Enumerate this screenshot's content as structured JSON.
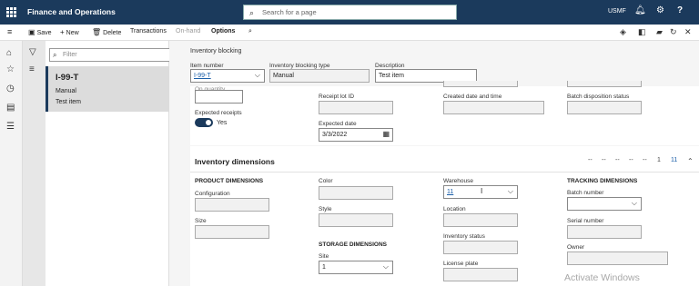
{
  "app": {
    "title": "Finance and Operations",
    "search_placeholder": "Search for a page",
    "company": "USMF"
  },
  "commands": {
    "save": "Save",
    "new": "New",
    "delete": "Delete",
    "transactions": "Transactions",
    "on_hand": "On-hand",
    "options": "Options"
  },
  "filter": {
    "placeholder": "Filter"
  },
  "list_item": {
    "id": "I-99-T",
    "type": "Manual",
    "description": "Test item"
  },
  "header": {
    "page_title": "Inventory blocking",
    "item_number_label": "Item number",
    "item_number_value": "I-99-T",
    "blocking_type_label": "Inventory blocking type",
    "blocking_type_value": "Manual",
    "description_label": "Description",
    "description_value": "Test item"
  },
  "general": {
    "quantity_label": "On quantity",
    "expected_receipts_label": "Expected receipts",
    "expected_receipts_value": "Yes",
    "receipt_lot_label": "Receipt lot ID",
    "expected_date_label": "Expected date",
    "expected_date_value": "3/3/2022",
    "created_label": "Created date and time",
    "batch_disposition_label": "Batch disposition status"
  },
  "dimensions": {
    "title": "Inventory dimensions",
    "pager": [
      "--",
      "--",
      "--",
      "--",
      "--",
      "1",
      "11"
    ],
    "product_heading": "PRODUCT DIMENSIONS",
    "configuration_label": "Configuration",
    "size_label": "Size",
    "color_label": "Color",
    "style_label": "Style",
    "storage_heading": "STORAGE DIMENSIONS",
    "site_label": "Site",
    "site_value": "1",
    "warehouse_label": "Warehouse",
    "warehouse_value": "11",
    "location_label": "Location",
    "inventory_status_label": "Inventory status",
    "license_plate_label": "License plate",
    "tracking_heading": "TRACKING DIMENSIONS",
    "batch_label": "Batch number",
    "serial_label": "Serial number",
    "owner_label": "Owner"
  },
  "watermark": "Activate Windows",
  "colors": {
    "topbar": "#1b3a5c",
    "accent": "#1b3a5c",
    "link": "#1a5ea8"
  }
}
